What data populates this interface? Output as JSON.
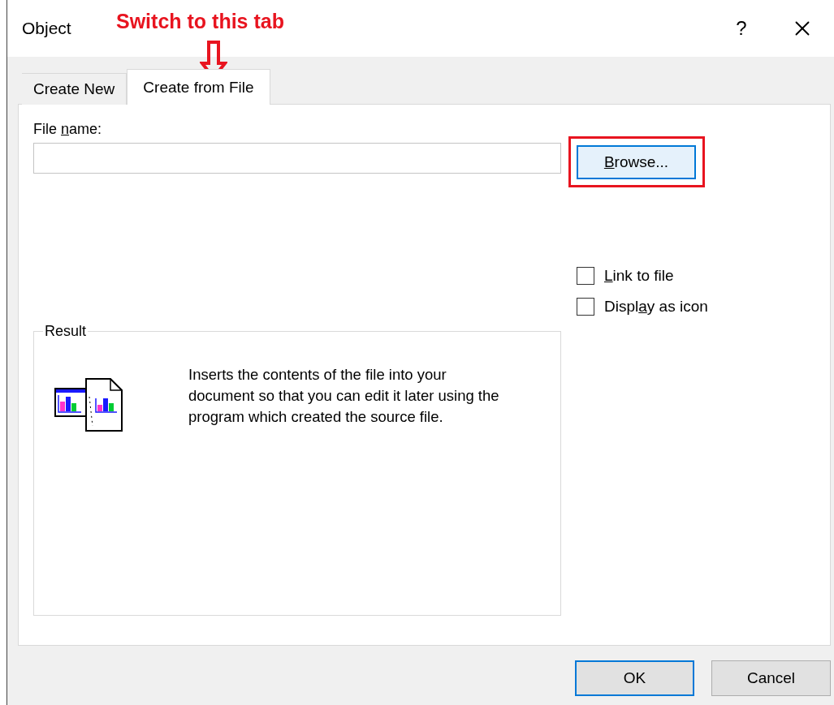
{
  "window": {
    "title": "Object",
    "help": "?"
  },
  "annotation": {
    "text": "Switch to this tab"
  },
  "tabs": [
    {
      "label": "Create New",
      "selected": false
    },
    {
      "label": "Create from File",
      "selected": true
    }
  ],
  "file_name": {
    "label": {
      "before": "File ",
      "key": "n",
      "after": "ame:"
    }
  },
  "browse_button": {
    "label": {
      "key": "B",
      "after": "rowse..."
    },
    "highlighted": true
  },
  "options": [
    {
      "label": {
        "key": "L",
        "after": "ink to file"
      },
      "checked": false
    },
    {
      "label": {
        "before": "Displ",
        "key": "a",
        "after": "y as icon"
      },
      "checked": false
    }
  ],
  "result": {
    "title": "Result",
    "text": "Inserts the contents of the file into your document so that you can edit it later using the program which created the source file."
  },
  "buttons": [
    {
      "label": "OK",
      "default": true
    },
    {
      "label": "Cancel",
      "default": false
    }
  ]
}
